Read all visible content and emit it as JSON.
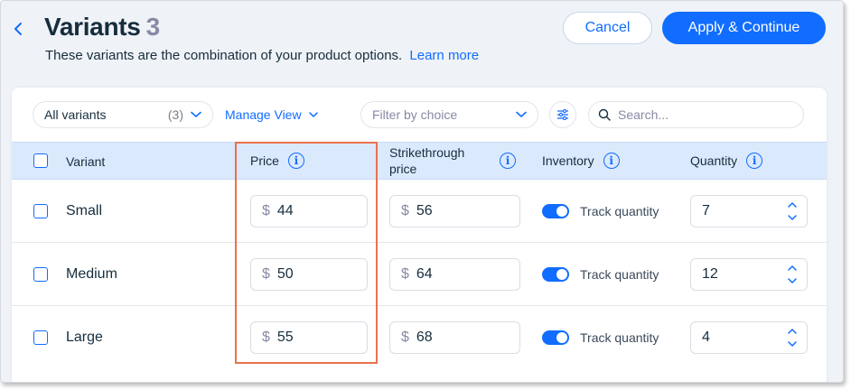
{
  "header": {
    "title": "Variants",
    "count": "3",
    "subtitle": "These variants are the combination of your product options.",
    "learn_more": "Learn more",
    "cancel_label": "Cancel",
    "apply_label": "Apply & Continue"
  },
  "toolbar": {
    "variants_select": {
      "label": "All variants",
      "count": "(3)"
    },
    "manage_view": "Manage View",
    "filter_placeholder": "Filter by choice",
    "search_placeholder": "Search..."
  },
  "table": {
    "columns": {
      "variant": "Variant",
      "price": "Price",
      "strike_line1": "Strikethrough",
      "strike_line2": "price",
      "inventory": "Inventory",
      "quantity": "Quantity"
    },
    "rows": [
      {
        "name": "Small",
        "currency": "$",
        "price": "44",
        "strikethrough": "56",
        "track_label": "Track quantity",
        "track_on": true,
        "quantity": "7"
      },
      {
        "name": "Medium",
        "currency": "$",
        "price": "50",
        "strikethrough": "64",
        "track_label": "Track quantity",
        "track_on": true,
        "quantity": "12"
      },
      {
        "name": "Large",
        "currency": "$",
        "price": "55",
        "strikethrough": "68",
        "track_label": "Track quantity",
        "track_on": true,
        "quantity": "4"
      }
    ]
  },
  "colors": {
    "accent": "#116dff",
    "header_bg": "#dbe9fd",
    "highlight": "#e9714f",
    "page_bg": "#eff2f7"
  }
}
